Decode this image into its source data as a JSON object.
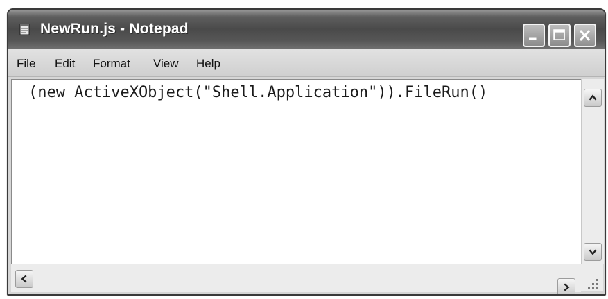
{
  "window": {
    "title": "NewRun.js - Notepad",
    "icon": "notepad-icon"
  },
  "caption_buttons": {
    "minimize_icon": "minimize-icon",
    "maximize_icon": "maximize-icon",
    "close_icon": "close-icon"
  },
  "menu": {
    "items": [
      "File",
      "Edit",
      "Format",
      "View",
      "Help"
    ]
  },
  "editor": {
    "content": "(new ActiveXObject(\"Shell.Application\")).FileRun()"
  },
  "scrollbars": {
    "up_icon": "arrow-up-icon",
    "down_icon": "arrow-down-icon",
    "left_icon": "arrow-left-icon",
    "right_icon": "arrow-right-icon"
  },
  "colors": {
    "titlebar": "#4a4a4a",
    "menubar": "#d6d6d6",
    "editor_background": "#ffffff"
  }
}
